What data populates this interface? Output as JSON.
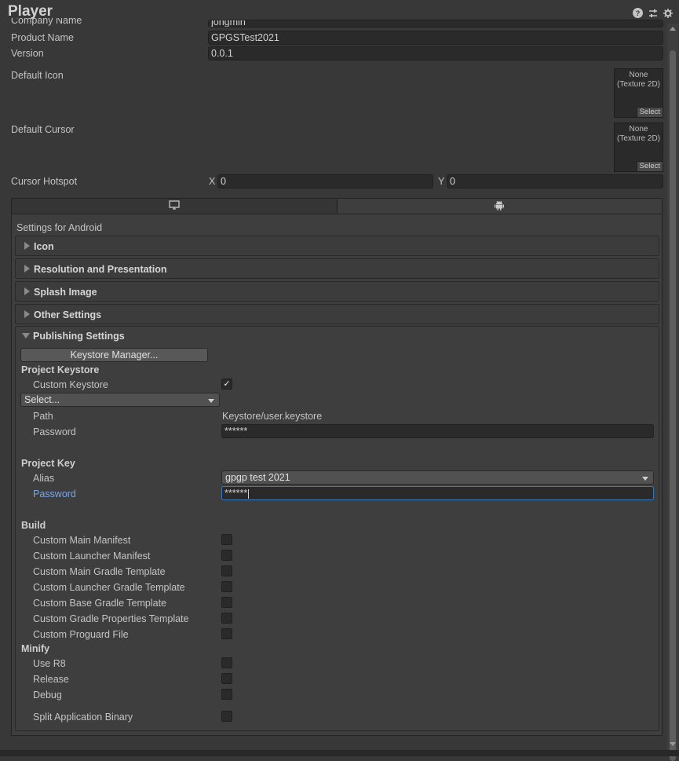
{
  "window": {
    "title": "Player",
    "icons": [
      "help-icon",
      "preset-icon",
      "gear-icon"
    ]
  },
  "top_fields": {
    "company_name_label": "Company Name",
    "company_name_value": "jongmin",
    "product_name_label": "Product Name",
    "product_name_value": "GPGSTest2021",
    "version_label": "Version",
    "version_value": "0.0.1",
    "default_icon_label": "Default Icon",
    "default_icon_value": "None\n(Texture 2D)",
    "default_icon_select": "Select",
    "default_cursor_label": "Default Cursor",
    "default_cursor_value": "None\n(Texture 2D)",
    "default_cursor_select": "Select",
    "cursor_hotspot_label": "Cursor Hotspot",
    "hotspot_x_label": "X",
    "hotspot_x_value": "0",
    "hotspot_y_label": "Y",
    "hotspot_y_value": "0"
  },
  "platform_tabs": {
    "tabs": [
      {
        "icon": "desktop-icon",
        "active": false
      },
      {
        "icon": "android-icon",
        "active": true
      }
    ]
  },
  "settings": {
    "header": "Settings for Android",
    "foldouts": [
      {
        "label": "Icon",
        "expanded": false
      },
      {
        "label": "Resolution and Presentation",
        "expanded": false
      },
      {
        "label": "Splash Image",
        "expanded": false
      },
      {
        "label": "Other Settings",
        "expanded": false
      },
      {
        "label": "Publishing Settings",
        "expanded": true
      }
    ]
  },
  "publishing": {
    "keystore_manager_button": "Keystore Manager...",
    "project_keystore_header": "Project Keystore",
    "custom_keystore_label": "Custom Keystore",
    "custom_keystore_checked": true,
    "keystore_dropdown": "Select...",
    "path_label": "Path",
    "path_value": "Keystore/user.keystore",
    "keystore_password_label": "Password",
    "keystore_password_value": "******",
    "project_key_header": "Project Key",
    "alias_label": "Alias",
    "alias_value": "gpgp test 2021",
    "key_password_label": "Password",
    "key_password_value": "******",
    "build_header": "Build",
    "build_options": [
      {
        "label": "Custom Main Manifest",
        "checked": false
      },
      {
        "label": "Custom Launcher Manifest",
        "checked": false
      },
      {
        "label": "Custom Main Gradle Template",
        "checked": false
      },
      {
        "label": "Custom Launcher Gradle Template",
        "checked": false
      },
      {
        "label": "Custom Base Gradle Template",
        "checked": false
      },
      {
        "label": "Custom Gradle Properties Template",
        "checked": false
      },
      {
        "label": "Custom Proguard File",
        "checked": false
      }
    ],
    "minify_header": "Minify",
    "minify_options": [
      {
        "label": "Use R8",
        "checked": false
      },
      {
        "label": "Release",
        "checked": false
      },
      {
        "label": "Debug",
        "checked": false
      }
    ],
    "split_binary_label": "Split Application Binary",
    "split_binary_checked": false
  }
}
